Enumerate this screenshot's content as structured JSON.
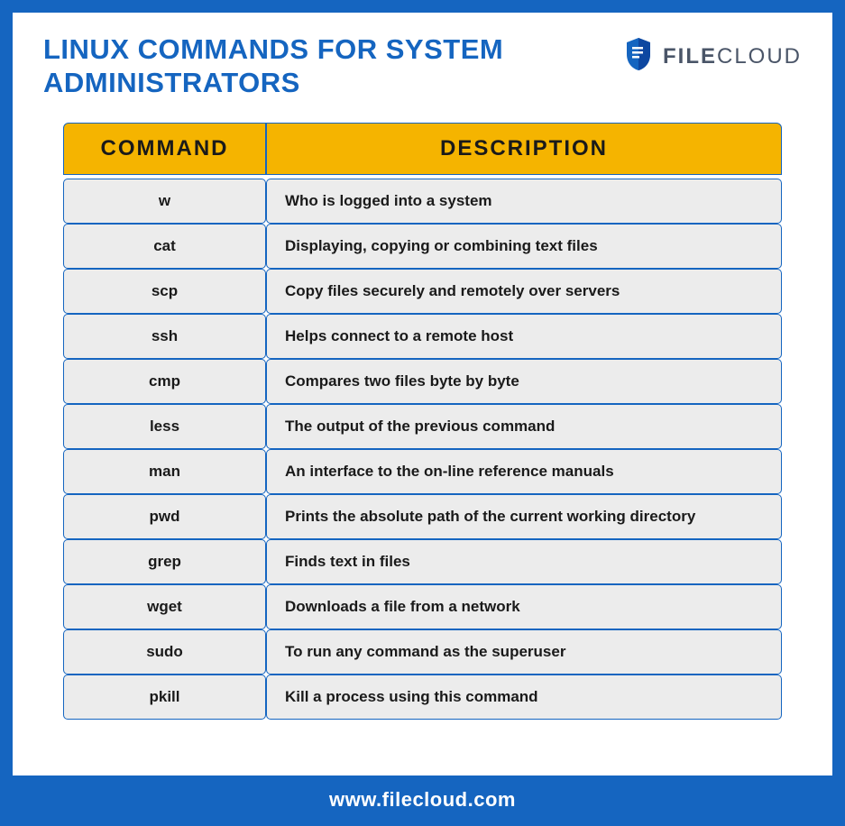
{
  "header": {
    "title": "LINUX COMMANDS FOR SYSTEM ADMINISTRATORS",
    "brand_prefix": "FILE",
    "brand_suffix": "CLOUD"
  },
  "table": {
    "col_command": "COMMAND",
    "col_description": "DESCRIPTION",
    "rows": [
      {
        "cmd": "w",
        "desc": "Who is logged into a system"
      },
      {
        "cmd": "cat",
        "desc": "Displaying, copying or combining text files"
      },
      {
        "cmd": "scp",
        "desc": "Copy files securely and remotely over servers"
      },
      {
        "cmd": "ssh",
        "desc": "Helps connect to a remote host"
      },
      {
        "cmd": "cmp",
        "desc": "Compares two files byte by byte"
      },
      {
        "cmd": "less",
        "desc": "The output of the previous command"
      },
      {
        "cmd": "man",
        "desc": "An interface to the on-line reference manuals"
      },
      {
        "cmd": "pwd",
        "desc": "Prints the absolute path of the current working directory"
      },
      {
        "cmd": "grep",
        "desc": "Finds text in files"
      },
      {
        "cmd": "wget",
        "desc": "Downloads a file from a network"
      },
      {
        "cmd": "sudo",
        "desc": "To run any command as the superuser"
      },
      {
        "cmd": "pkill",
        "desc": "Kill a process using this command"
      }
    ]
  },
  "footer": {
    "url": "www.filecloud.com"
  }
}
